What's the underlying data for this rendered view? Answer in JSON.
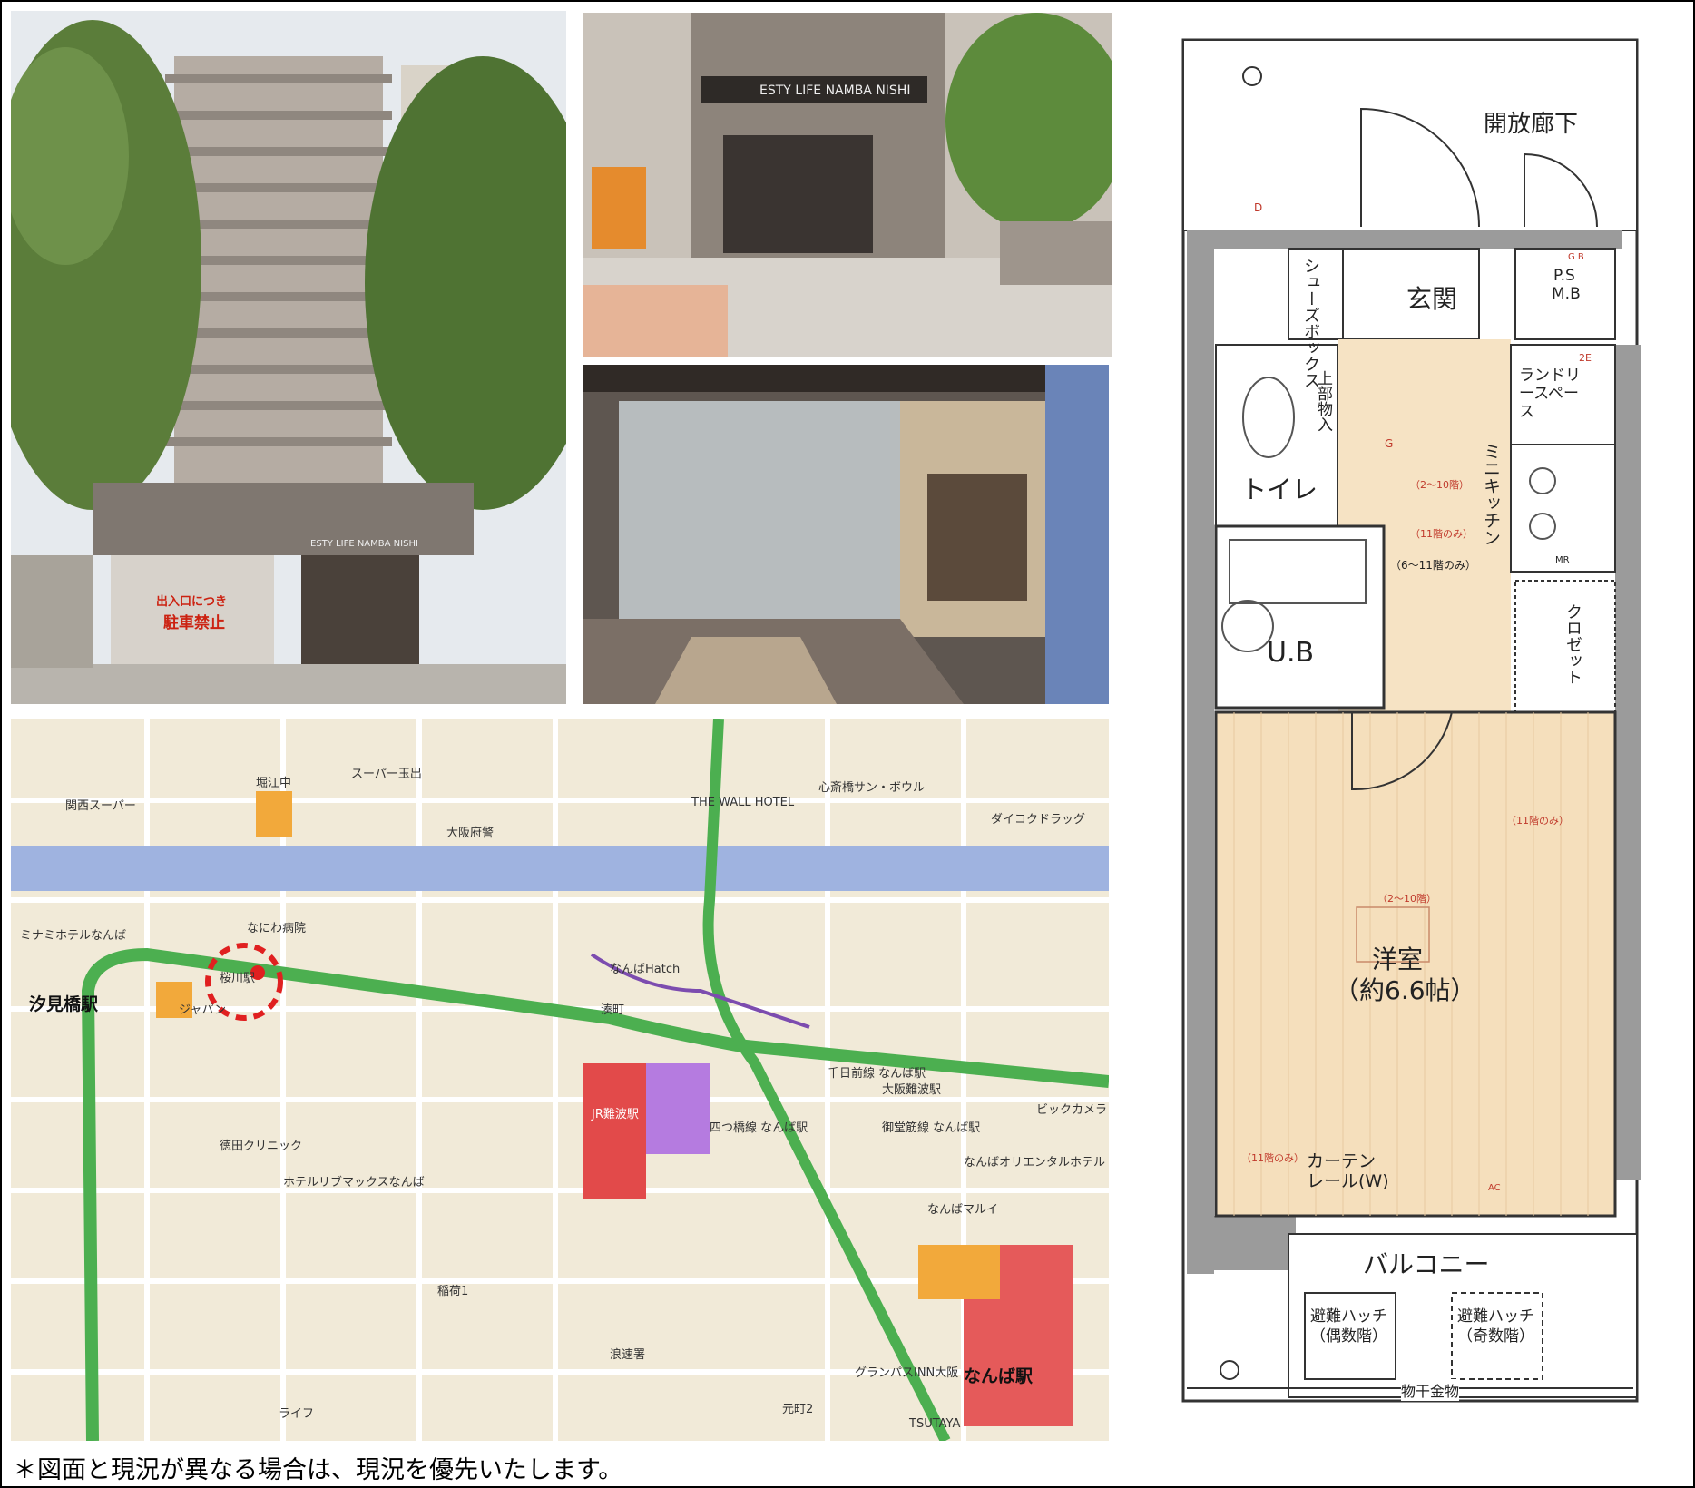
{
  "building_sign": "ESTY LIFE NAMBA NISHI",
  "shutter_sign": [
    "出入口につき",
    "駐車禁止"
  ],
  "floorplan": {
    "corridor": "開放廊下",
    "shoe_box": "シューズボックス",
    "entrance": "玄関",
    "ps_mb": [
      "P.S",
      "M.B"
    ],
    "laundry": "ランドリースペース",
    "storage": "上部物入",
    "toilet": "トイレ",
    "kitchen": "ミニキッチン",
    "ub": "U.B",
    "closet": "クロゼット",
    "room": "洋室",
    "room_size": "（約6.6帖）",
    "curtain_rail": [
      "カーテン",
      "レール(W)"
    ],
    "balcony": "バルコニー",
    "hatch_even": [
      "避難ハッチ",
      "（偶数階）"
    ],
    "hatch_odd": [
      "避難ハッチ",
      "（奇数階）"
    ],
    "laundry_rod": "物干金物",
    "notes": {
      "floors_2_10_a": "（2～10階）",
      "floors_11_a": "（11階のみ）",
      "floors_6_11": "（6～11階のみ）",
      "floors_11_b": "（11階のみ）",
      "floors_2_10_b": "（2～10階）",
      "floors_11_c": "（11階のみ）"
    },
    "symbols": {
      "d": "D",
      "g": "G",
      "ac": "AC",
      "mr": "MR",
      "gb": "G  B",
      "two_e": "2E"
    }
  },
  "map": {
    "stations": [
      "汐見橋駅",
      "なんば駅",
      "JR難波駅",
      "四つ橋線 なんば駅",
      "千日前線 なんば駅",
      "御堂筋線 なんば駅",
      "大阪難波駅",
      "桜川駅"
    ],
    "labels": [
      "堀江中",
      "なにわ病院",
      "ジャパン",
      "徳田クリニック",
      "ホテルリブマックスなんば",
      "湊町",
      "なんばHatch",
      "ビックカメラ",
      "なんばマルイ",
      "浪速署",
      "TSUTAYA",
      "ライフ",
      "ダイコクドラッグ",
      "心斎橋サン・ボウル",
      "大阪府警",
      "ミナミホテルなんば",
      "関西スーパー",
      "スーパー玉出",
      "THE WALL HOTEL",
      "グランパスINN大阪",
      "なんばオリエンタルホテル",
      "元町2",
      "稲荷1"
    ],
    "marker_color": "#e02020",
    "rail_color": "#4caf50",
    "river_color": "#9fb3e0"
  },
  "footnote": "＊図面と現況が異なる場合は、現況を優先いたします。"
}
